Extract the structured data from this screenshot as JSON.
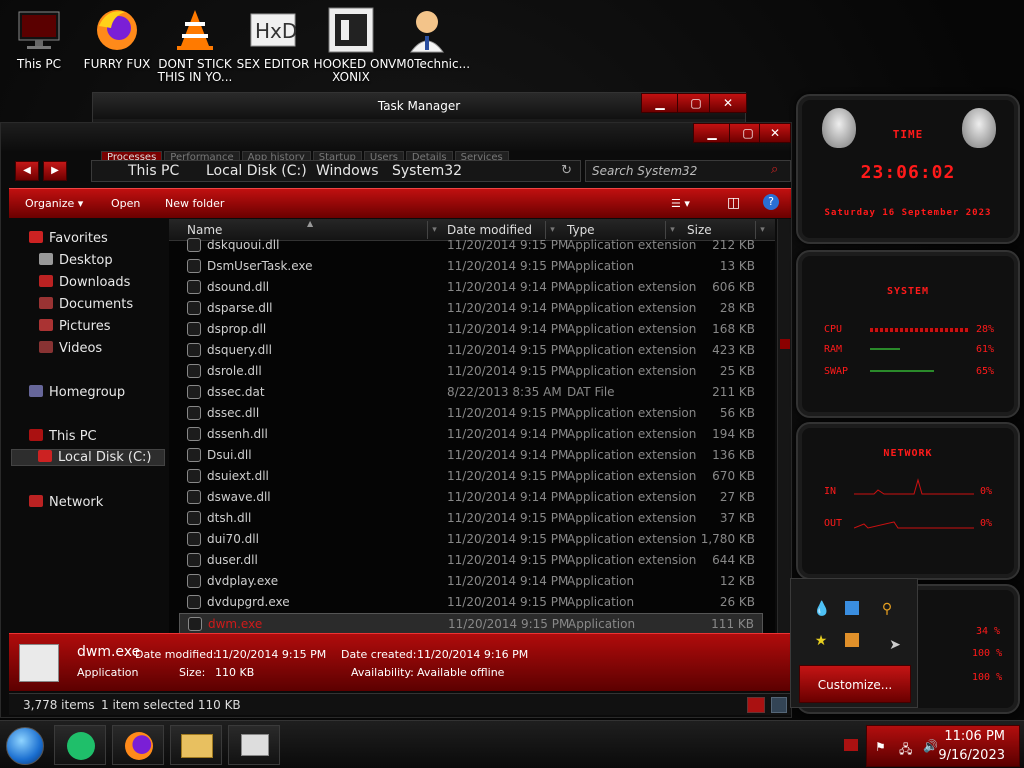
{
  "desktop_icons": [
    {
      "label": "This PC",
      "icon": "monitor-icon"
    },
    {
      "label": "FURRY FUX",
      "icon": "firefox-icon"
    },
    {
      "label": "DONT STICK THIS IN YO...",
      "icon": "vlc-cone-icon"
    },
    {
      "label": "SEX EDITOR",
      "icon": "hex-editor-icon"
    },
    {
      "label": "HOOKED ON XONIX",
      "icon": "xonix-game-icon"
    },
    {
      "label": "VM0Technic...",
      "icon": "doctor-avatar-icon"
    }
  ],
  "taskmgr": {
    "title": "Task Manager",
    "tabs": [
      "Processes",
      "Performance",
      "App history",
      "Startup",
      "Users",
      "Details",
      "Services"
    ]
  },
  "explorer": {
    "breadcrumb": [
      "This PC",
      "Local Disk (C:)",
      "Windows",
      "System32"
    ],
    "search_placeholder": "Search System32",
    "commands": {
      "organize": "Organize ▾",
      "open": "Open",
      "new_folder": "New folder"
    },
    "nav": {
      "favorites": "Favorites",
      "desktop": "Desktop",
      "downloads": "Downloads",
      "documents": "Documents",
      "pictures": "Pictures",
      "videos": "Videos",
      "homegroup": "Homegroup",
      "this_pc": "This PC",
      "local_disk": "Local Disk (C:)",
      "network": "Network"
    },
    "columns": {
      "name": "Name",
      "date": "Date modified",
      "type": "Type",
      "size": "Size"
    },
    "files": [
      {
        "name": "dskquoui.dll",
        "date": "11/20/2014 9:15 PM",
        "type": "Application extension",
        "size": "212 KB"
      },
      {
        "name": "DsmUserTask.exe",
        "date": "11/20/2014 9:15 PM",
        "type": "Application",
        "size": "13 KB"
      },
      {
        "name": "dsound.dll",
        "date": "11/20/2014 9:14 PM",
        "type": "Application extension",
        "size": "606 KB"
      },
      {
        "name": "dsparse.dll",
        "date": "11/20/2014 9:14 PM",
        "type": "Application extension",
        "size": "28 KB"
      },
      {
        "name": "dsprop.dll",
        "date": "11/20/2014 9:14 PM",
        "type": "Application extension",
        "size": "168 KB"
      },
      {
        "name": "dsquery.dll",
        "date": "11/20/2014 9:15 PM",
        "type": "Application extension",
        "size": "423 KB"
      },
      {
        "name": "dsrole.dll",
        "date": "11/20/2014 9:15 PM",
        "type": "Application extension",
        "size": "25 KB"
      },
      {
        "name": "dssec.dat",
        "date": "8/22/2013 8:35 AM",
        "type": "DAT File",
        "size": "211 KB"
      },
      {
        "name": "dssec.dll",
        "date": "11/20/2014 9:15 PM",
        "type": "Application extension",
        "size": "56 KB"
      },
      {
        "name": "dssenh.dll",
        "date": "11/20/2014 9:14 PM",
        "type": "Application extension",
        "size": "194 KB"
      },
      {
        "name": "Dsui.dll",
        "date": "11/20/2014 9:14 PM",
        "type": "Application extension",
        "size": "136 KB"
      },
      {
        "name": "dsuiext.dll",
        "date": "11/20/2014 9:15 PM",
        "type": "Application extension",
        "size": "670 KB"
      },
      {
        "name": "dswave.dll",
        "date": "11/20/2014 9:14 PM",
        "type": "Application extension",
        "size": "27 KB"
      },
      {
        "name": "dtsh.dll",
        "date": "11/20/2014 9:15 PM",
        "type": "Application extension",
        "size": "37 KB"
      },
      {
        "name": "dui70.dll",
        "date": "11/20/2014 9:15 PM",
        "type": "Application extension",
        "size": "1,780 KB"
      },
      {
        "name": "duser.dll",
        "date": "11/20/2014 9:15 PM",
        "type": "Application extension",
        "size": "644 KB"
      },
      {
        "name": "dvdplay.exe",
        "date": "11/20/2014 9:14 PM",
        "type": "Application",
        "size": "12 KB"
      },
      {
        "name": "dvdupgrd.exe",
        "date": "11/20/2014 9:15 PM",
        "type": "Application",
        "size": "26 KB"
      },
      {
        "name": "dwm.exe",
        "date": "11/20/2014 9:15 PM",
        "type": "Application",
        "size": "111 KB"
      }
    ],
    "details": {
      "name": "dwm.exe",
      "type": "Application",
      "date_modified_label": "Date modified:",
      "date_modified": "11/20/2014 9:15 PM",
      "size_label": "Size:",
      "size": "110 KB",
      "date_created_label": "Date created:",
      "date_created": "11/20/2014 9:16 PM",
      "availability_label": "Availability:",
      "availability": "Available offline"
    },
    "status": {
      "items": "3,778 items",
      "selected": "1 item selected  110 KB"
    }
  },
  "gadgets": {
    "time": {
      "label": "TIME",
      "clock": "23:06:02",
      "date": "Saturday 16 September 2023"
    },
    "system": {
      "label": "SYSTEM",
      "cpu": "CPU",
      "ram": "RAM",
      "swap": "SWAP",
      "cpu_val": "28%",
      "ram_val": "61%",
      "swap_val": "65%"
    },
    "network": {
      "label": "NETWORK",
      "in": "IN",
      "out": "OUT",
      "in_val": "0%",
      "out_val": "0%"
    },
    "disk_vals": [
      "34 %",
      "100 %",
      "100 %"
    ]
  },
  "tray": {
    "customize": "Customize..."
  },
  "taskbar": {
    "time": "11:06 PM",
    "date": "9/16/2023"
  },
  "colors": {
    "accent": "#c01010",
    "accent_dark": "#6a0000",
    "gadget_red": "#ff1a1a"
  }
}
